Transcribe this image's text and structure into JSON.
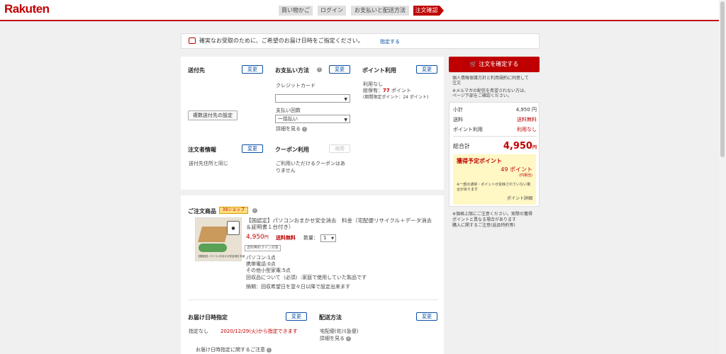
{
  "header": {
    "logo": "Rakuten",
    "steps": [
      "買い物かご",
      "ログイン",
      "お支払いと配送方法",
      "注文確認"
    ]
  },
  "notice": {
    "text": "確実なお受取のために、ご希望のお届け日時をご指定ください。",
    "link": "指定する"
  },
  "shipping": {
    "title": "送付先",
    "change": "変更",
    "multi_button": "複数送付先の設定"
  },
  "payment": {
    "title": "お支払い方法",
    "change": "変更",
    "method_label": "クレジットカード",
    "method_value": "",
    "installments_label": "支払い回数",
    "installments_value": "一括払い",
    "details_link": "詳細を見る"
  },
  "points": {
    "title": "ポイント利用",
    "change": "変更",
    "usage": "利用なし",
    "owned_prefix": "総保有：",
    "owned_value": "77",
    "owned_unit": " ポイント",
    "limited": "(期間限定ポイント：24 ポイント)"
  },
  "orderer": {
    "title": "注文者情報",
    "change": "変更",
    "value": "送付先住所と同じ"
  },
  "coupon": {
    "title": "クーポン利用",
    "button": "適用",
    "text_line1": "ご利用いただけるクーポンはあ",
    "text_line2": "りません"
  },
  "products": {
    "title": "ご注文商品",
    "shop_tag": "39ショップ",
    "item": {
      "name_line1": "【国認定】パソコンおまかせ安全消去　料金（宅配便リサイクル＋データ消去",
      "name_line2": "＆証明書１台付き）",
      "price": "4,950",
      "price_unit": "円",
      "shipping": "送料無料",
      "qty_label": "数量：",
      "qty_value": "1",
      "tag": "送料無料ライン対象",
      "details": [
        "パソコン:1点",
        "携帯電話:0点",
        "その他小型家電:5点",
        "回収品について（必須）:家庭で使用していた製品です",
        "納期：回収希望日を翌々日以降で設定出来ます"
      ],
      "thumb_caption": "【国認定】パソコンおまかせ安全消去 料金"
    }
  },
  "delivery_date": {
    "title": "お届け日時指定",
    "change": "変更",
    "none": "指定なし",
    "available": "2020/12/29(火)から指定できます",
    "note_link": "お届け日時指定に関するご注意"
  },
  "delivery_method": {
    "title": "配送方法",
    "change": "変更",
    "value": "宅配便(佐川急便)",
    "details_link": "詳細を見る"
  },
  "sidebar": {
    "confirm_button": "注文を確定する",
    "agree_line1": "個人情報保護方針と利用規約に同意して",
    "agree_line2": "注文",
    "mail_line1": "※メルマガの配信を希望されない方は、",
    "mail_line2": "ページ下部をご確認ください。",
    "subtotal_label": "小計",
    "subtotal_value": "4,950 円",
    "shipping_label": "送料",
    "shipping_value": "送料無料",
    "points_label": "ポイント利用",
    "points_value": "利用なし",
    "total_label": "総合計",
    "total_value": "4,950",
    "total_unit": "円",
    "earn_title": "獲得予定ポイント",
    "earn_value": "49 ポイント",
    "earn_equiv": "(円相当)",
    "earn_note1": "※一部の通常・ポイントが反映されていない場",
    "earn_note2": "合があります",
    "earn_link": "ポイント詳細",
    "note1": "※価格上限にご注意ください。実際の獲得",
    "note2": "ポイントと異なる場合があります",
    "note3": "購入に関するご注意(返品特約等)"
  },
  "colors": {
    "brand": "#bf0000",
    "link": "#0a4fa6",
    "point_box": "#fff7c4"
  }
}
